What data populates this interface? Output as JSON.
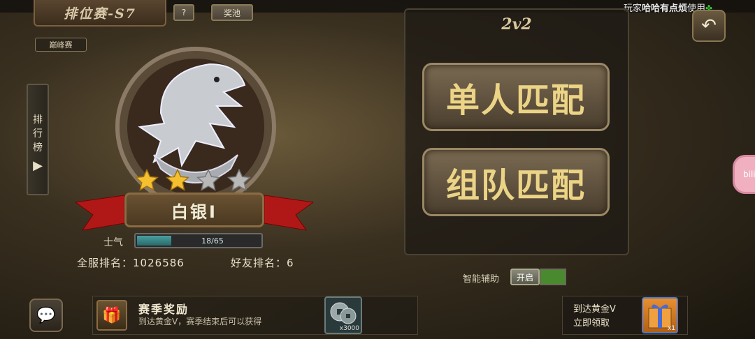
{
  "header": {
    "title": "排位赛-S7",
    "help_label": "?",
    "pool_label": "奖池",
    "peak_label": "巅峰赛",
    "player_prefix": "玩家",
    "player_name": "哈哈有点烦",
    "player_suffix": "使用"
  },
  "sidebar": {
    "leaderboard_chars": [
      "排",
      "行",
      "榜"
    ],
    "arrow": "▶"
  },
  "rank": {
    "tier": "白银Ⅰ",
    "stars_filled": 2,
    "stars_total": 4,
    "morale_label": "士气",
    "morale_value": "18/65",
    "morale_fraction": 0.277,
    "server_rank_label": "全服排名：",
    "server_rank": "1026586",
    "friend_rank_label": "好友排名：",
    "friend_rank": "6"
  },
  "modes": {
    "title": "2v2",
    "solo_label": "单人匹配",
    "team_label": "组队匹配"
  },
  "assist": {
    "label": "智能辅助",
    "toggle_label": "开启"
  },
  "rewards": {
    "title": "赛季奖励",
    "desc": "到达黄金Ⅴ，赛季结束后可以获得",
    "coin_qty": "x3000",
    "gold_line1": "到达黄金Ⅴ",
    "gold_line2": "立即领取",
    "gold_qty": "x1"
  },
  "icons": {
    "back": "back-arrow-icon",
    "chat": "chat-bubble-icon",
    "gift": "gift-box-icon",
    "coin": "copper-coin-icon",
    "star": "star-icon",
    "eagle": "eagle-badge-icon"
  },
  "colors": {
    "star_gold": "#f5c030",
    "star_empty": "#b8b8b8",
    "ribbon_red": "#b01818",
    "mode_text": "#ecd486",
    "assist_green": "#4a8a2e"
  }
}
